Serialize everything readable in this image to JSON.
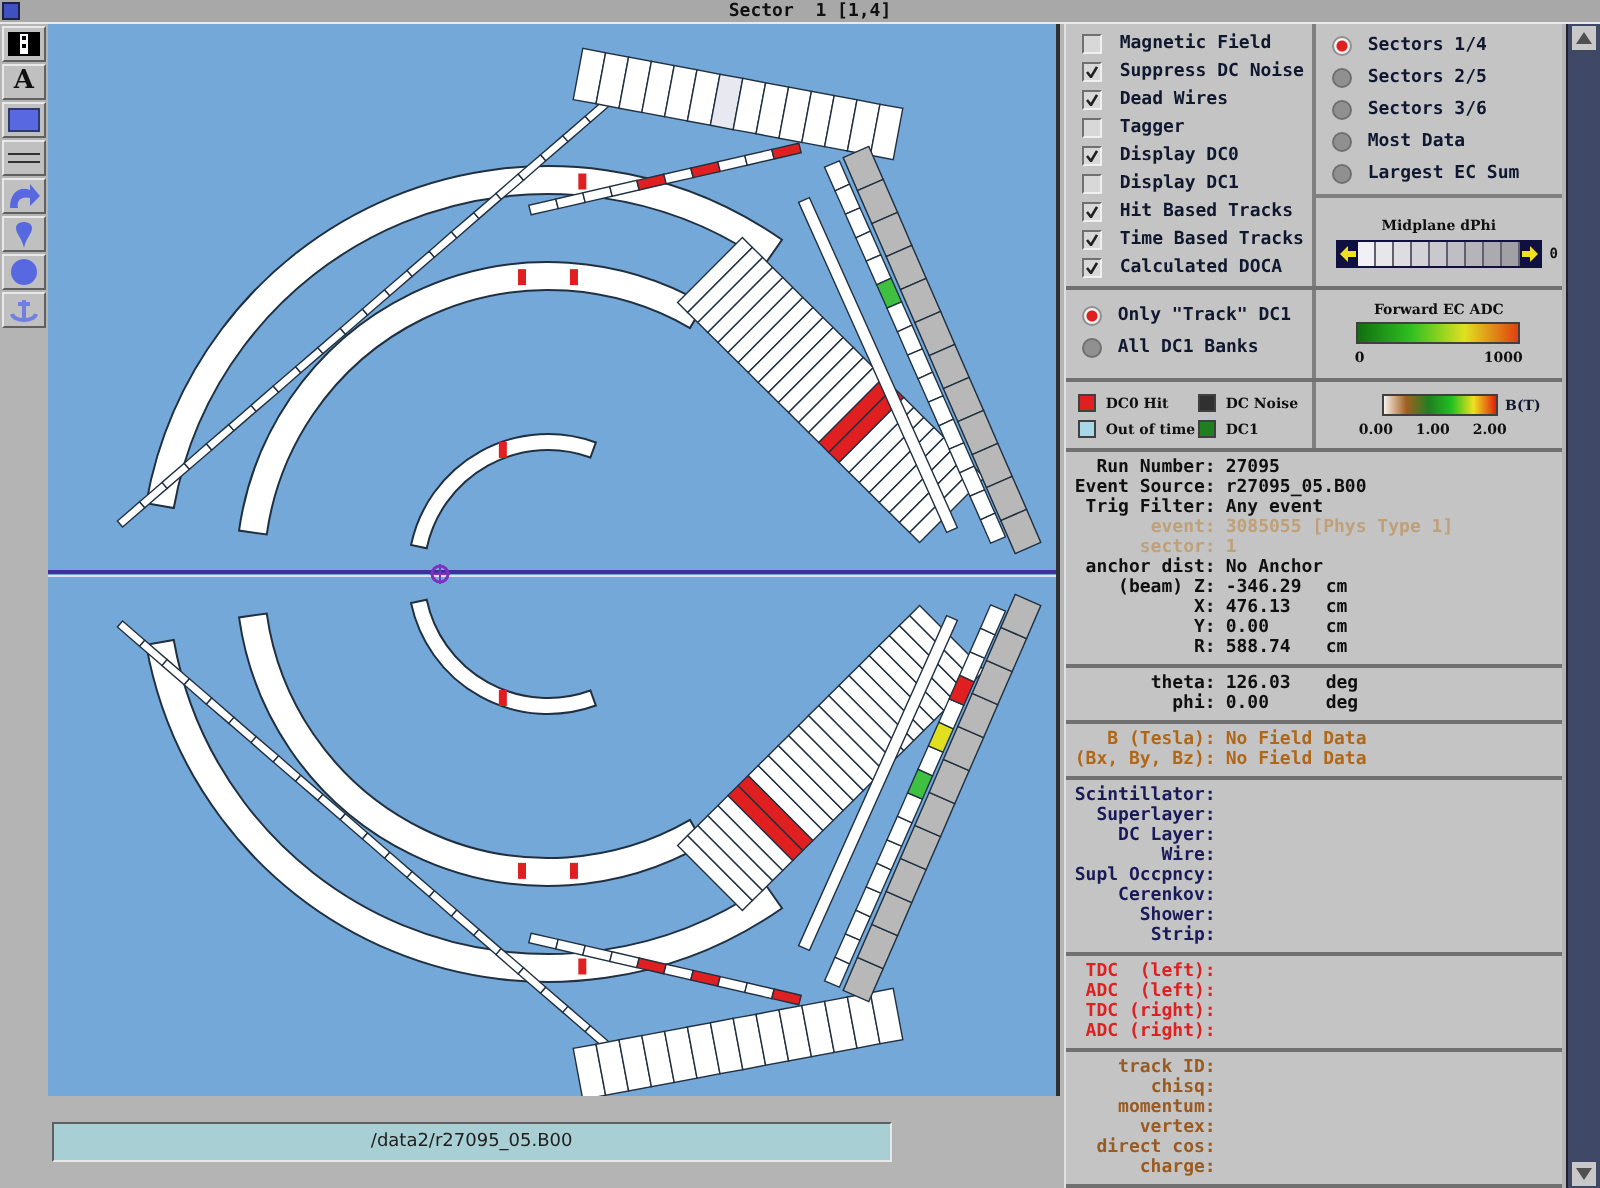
{
  "window": {
    "title": "Sector  1 [1,4]"
  },
  "tools": [
    {
      "kind": "pattern"
    },
    {
      "kind": "text",
      "label": "A"
    },
    {
      "kind": "rect"
    },
    {
      "kind": "lines"
    },
    {
      "kind": "arrow"
    },
    {
      "kind": "drop"
    },
    {
      "kind": "circle"
    },
    {
      "kind": "anchor"
    }
  ],
  "options": [
    {
      "label": "Magnetic Field",
      "checked": false
    },
    {
      "label": "Suppress DC Noise",
      "checked": true
    },
    {
      "label": "Dead Wires",
      "checked": true
    },
    {
      "label": "Tagger",
      "checked": false
    },
    {
      "label": "Display DC0",
      "checked": true
    },
    {
      "label": "Display DC1",
      "checked": false
    },
    {
      "label": "Hit Based Tracks",
      "checked": true
    },
    {
      "label": "Time Based Tracks",
      "checked": true
    },
    {
      "label": "Calculated DOCA",
      "checked": true
    }
  ],
  "sectors": [
    {
      "label": "Sectors 1/4",
      "selected": true
    },
    {
      "label": "Sectors 2/5",
      "selected": false
    },
    {
      "label": "Sectors 3/6",
      "selected": false
    },
    {
      "label": "Most Data",
      "selected": false
    },
    {
      "label": "Largest EC Sum",
      "selected": false
    }
  ],
  "dphi": {
    "title": "Midplane dPhi",
    "reading": "0"
  },
  "dc1_mode": [
    {
      "label": "Only \"Track\" DC1",
      "selected": true
    },
    {
      "label": "All DC1 Banks",
      "selected": false
    }
  ],
  "ec_adc": {
    "title": "Forward EC ADC",
    "min": "0",
    "max": "1000"
  },
  "legend": [
    {
      "label": "DC0 Hit",
      "color": "#e02020"
    },
    {
      "label": "DC Noise",
      "color": "#303030"
    },
    {
      "label": "Out of time",
      "color": "#a8d8e8"
    },
    {
      "label": "DC1",
      "color": "#208020"
    }
  ],
  "field_scale": {
    "title": "B(T)",
    "ticks": [
      "0.00",
      "1.00",
      "2.00"
    ]
  },
  "info_sections": [
    {
      "kind": "event",
      "rows": [
        {
          "label": "Run Number:",
          "value": "27095",
          "dimmed": false
        },
        {
          "label": "Event Source:",
          "value": "r27095_05.B00",
          "dimmed": false
        },
        {
          "label": "Trig Filter:",
          "value": "Any event",
          "dimmed": false
        },
        {
          "label": "event:",
          "value": "3085055 [Phys Type 1]",
          "dimmed": true
        },
        {
          "label": "sector:",
          "value": "1",
          "dimmed": true
        },
        {
          "label": "anchor dist:",
          "value": "No Anchor",
          "dimmed": false
        },
        {
          "label": "(beam) Z:",
          "value": "-346.29",
          "unit": "cm",
          "dimmed": false
        },
        {
          "label": "X:",
          "value": "476.13",
          "unit": "cm",
          "dimmed": false
        },
        {
          "label": "Y:",
          "value": "0.00",
          "unit": "cm",
          "dimmed": false
        },
        {
          "label": "R:",
          "value": "588.74",
          "unit": "cm",
          "dimmed": false
        }
      ]
    },
    {
      "kind": "event",
      "rows": [
        {
          "label": "theta:",
          "value": "126.03",
          "unit": "deg",
          "dimmed": false
        },
        {
          "label": "phi:",
          "value": "0.00",
          "unit": "deg",
          "dimmed": false
        }
      ]
    },
    {
      "kind": "field",
      "rows": [
        {
          "label": "B (Tesla):",
          "value": "No Field Data"
        },
        {
          "label": "(Bx, By, Bz):",
          "value": "No Field Data"
        }
      ]
    },
    {
      "kind": "hit",
      "rows": [
        {
          "label": "Scintillator:"
        },
        {
          "label": "Superlayer:"
        },
        {
          "label": "DC Layer:"
        },
        {
          "label": "Wire:"
        },
        {
          "label": "Supl Occpncy:"
        },
        {
          "label": "Cerenkov:"
        },
        {
          "label": "Shower:"
        },
        {
          "label": "Strip:"
        }
      ]
    },
    {
      "kind": "adc",
      "rows": [
        {
          "label": "TDC  (left):"
        },
        {
          "label": "ADC  (left):"
        },
        {
          "label": "TDC (right):"
        },
        {
          "label": "ADC (right):"
        }
      ]
    },
    {
      "kind": "track",
      "rows": [
        {
          "label": "track ID:"
        },
        {
          "label": "chisq:"
        },
        {
          "label": "momentum:"
        },
        {
          "label": "vertex:"
        },
        {
          "label": "direct cos:"
        },
        {
          "label": "charge:"
        }
      ]
    }
  ],
  "file_path": "/data2/r27095_05.B00"
}
